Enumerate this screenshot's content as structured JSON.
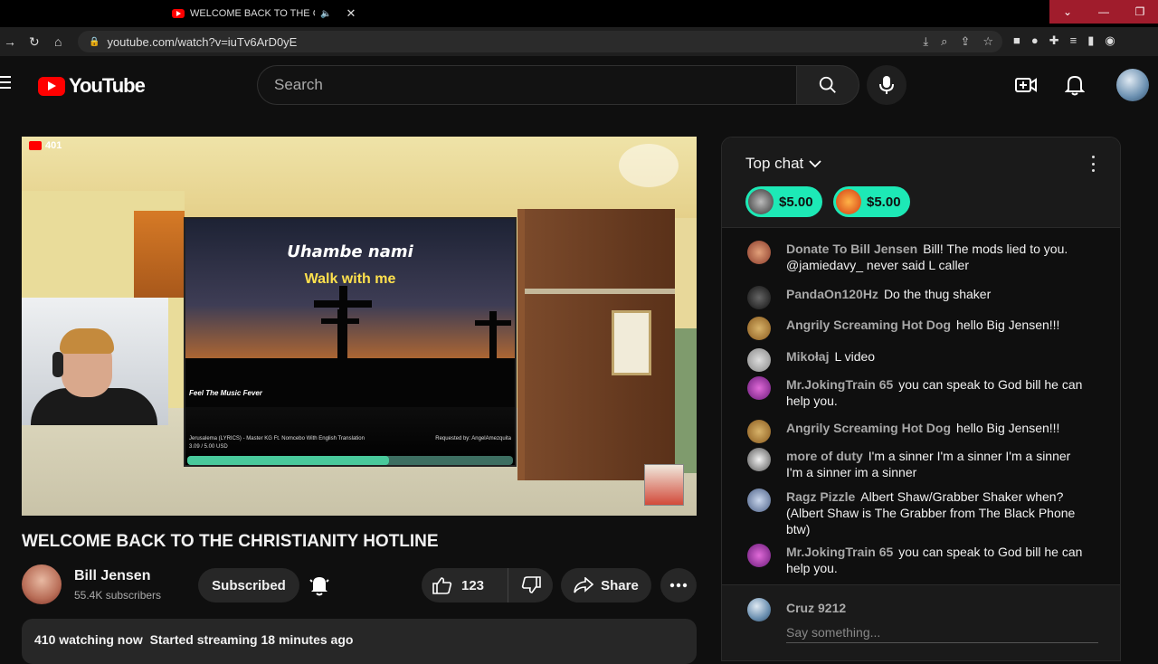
{
  "browser": {
    "tab_title": "WELCOME BACK TO THE CHRISTIANITY HOTLINE",
    "url": "youtube.com/watch?v=iuTv6ArD0yE",
    "window_buttons": [
      "⌄",
      "—",
      "❐"
    ]
  },
  "header": {
    "logo_text": "YouTube",
    "search_placeholder": "Search"
  },
  "video": {
    "live_viewers_badge": "401",
    "screen": {
      "line1": "Uhambe nami",
      "line2": "Walk with me",
      "watermark": "Feel The Music Fever",
      "song_info": "Jerusalema (LYRICS) - Master KG Ft. Nomcebo With English Translation",
      "amount": "3.09 / 5.00 USD",
      "requested_by": "Requested by: AngelAmezquita",
      "progress_fraction": 0.62
    },
    "title": "WELCOME BACK TO THE CHRISTIANITY HOTLINE"
  },
  "channel": {
    "name": "Bill Jensen",
    "subscribers": "55.4K subscribers",
    "subscribe_label": "Subscribed"
  },
  "actions": {
    "like_count": "123",
    "share_label": "Share"
  },
  "description": {
    "summary": "410 watching now  Started streaming 18 minutes ago"
  },
  "chat": {
    "header_label": "Top chat",
    "donations": [
      {
        "amount": "$5.00",
        "color": "#1de9b6"
      },
      {
        "amount": "$5.00",
        "color": "#1de9b6"
      }
    ],
    "messages": [
      {
        "author": "Donate To Bill Jensen",
        "text": "Bill! The mods lied to you. @jamiedavy_ never said L caller"
      },
      {
        "author": "PandaOn120Hz",
        "text": "Do the thug shaker"
      },
      {
        "author": "Angrily Screaming Hot Dog",
        "text": "hello Big Jensen!!!"
      },
      {
        "author": "Mikołaj",
        "text": "L video"
      },
      {
        "author": "Mr.JokingTrain 65",
        "text": "you can speak to God bill he can help you."
      },
      {
        "author": "Angrily Screaming Hot Dog",
        "text": "hello Big Jensen!!!"
      },
      {
        "author": "more of duty",
        "text": "I'm a sinner I'm a sinner I'm a sinner I'm a sinner im a sinner"
      },
      {
        "author": "Ragz Pizzle",
        "text": "Albert Shaw/Grabber Shaker when? (Albert Shaw is The Grabber from The Black Phone btw)"
      },
      {
        "author": "Mr.JokingTrain 65",
        "text": "you can speak to God bill he can help you."
      }
    ],
    "current_user": "Cruz 9212",
    "input_placeholder": "Say something..."
  }
}
